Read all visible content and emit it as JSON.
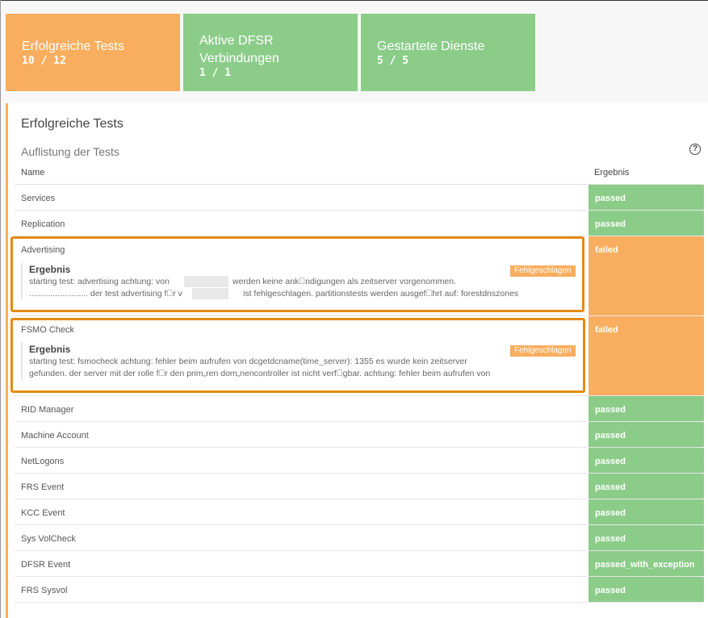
{
  "tiles": [
    {
      "label": "Erfolgreiche Tests",
      "value": "10 / 12",
      "color": "#f8ae5e"
    },
    {
      "label": "Aktive DFSR Verbindungen",
      "value": "1 / 1",
      "color": "#8ccc89"
    },
    {
      "label": "Gestartete Dienste",
      "value": "5 / 5",
      "color": "#8ccc89"
    }
  ],
  "panel": {
    "title": "Erfolgreiche Tests",
    "subtitle": "Auflistung der Tests",
    "help_icon": "question-circle-icon",
    "columns": {
      "name": "Name",
      "result": "Ergebnis"
    }
  },
  "rows": [
    {
      "name": "Services",
      "result": "passed"
    },
    {
      "name": "Replication",
      "result": "passed"
    },
    {
      "name": "Advertising",
      "result": "failed",
      "detail": {
        "title": "Ergebnis",
        "badge": "Fehlgeschlagen",
        "line1a": "starting test: advertising achtung: von",
        "line1b": "werden keine ank\u0000ndigungen als zeitserver vorgenommen.",
        "line2a": "......................... der test advertising f\u0000r v",
        "line2b": "ist fehlgeschlagen. partitionstests werden ausgef\u0000hrt auf: forestdnszones"
      }
    },
    {
      "name": "FSMO Check",
      "result": "failed",
      "detail": {
        "title": "Ergebnis",
        "badge": "Fehlgeschlagen",
        "line1": "starting test: fsmocheck achtung: fehler beim aufrufen von dcgetdcname(time_server): 1355 es wurde kein zeitserver",
        "line2": "gefunden. der server mit der rolle f\u0000r den prim„ren dom„nencontroller ist nicht verf\u0000gbar. achtung: fehler beim aufrufen von"
      }
    },
    {
      "name": "RID Manager",
      "result": "passed"
    },
    {
      "name": "Machine Account",
      "result": "passed"
    },
    {
      "name": "NetLogons",
      "result": "passed"
    },
    {
      "name": "FRS Event",
      "result": "passed"
    },
    {
      "name": "KCC Event",
      "result": "passed"
    },
    {
      "name": "Sys VolCheck",
      "result": "passed"
    },
    {
      "name": "DFSR Event",
      "result": "passed_with_exception"
    },
    {
      "name": "FRS Sysvol",
      "result": "passed"
    }
  ],
  "colors": {
    "passed": "#8ccc89",
    "failed": "#f8ae5e",
    "highlight": "#e58a14"
  }
}
